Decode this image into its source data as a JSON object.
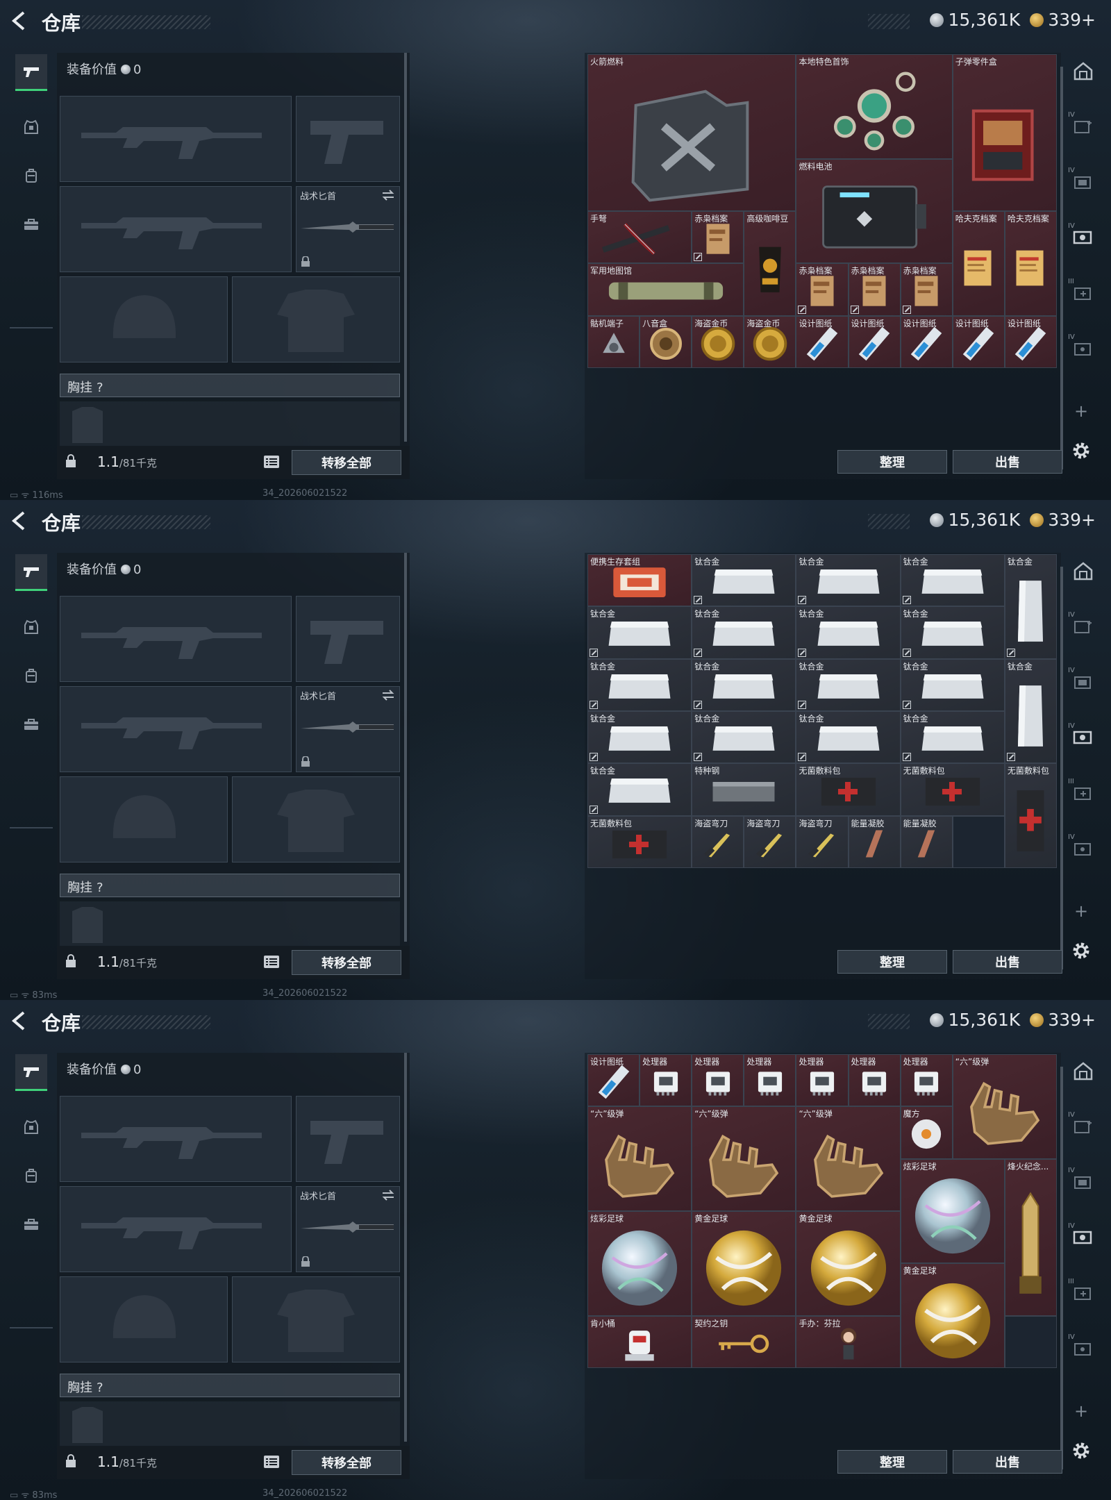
{
  "header": {
    "title": "仓库",
    "silver": "15,361K",
    "gold": "339+"
  },
  "equipment": {
    "value_label": "装备价值",
    "value": "0",
    "knife_label": "战术匕首",
    "chest_label": "胸挂",
    "chest_q": "?",
    "weight": "1.1",
    "weight_max": "/81千克",
    "transfer_label": "转移全部"
  },
  "stash_buttons": {
    "sort": "整理",
    "sell": "出售"
  },
  "build": "34_202606021522",
  "panels": [
    {
      "ping": "116ms",
      "items": [
        {
          "name": "火箭燃料",
          "c": 1,
          "r": 1,
          "cs": 4,
          "rs": 3,
          "t": "rare",
          "icon": "jerrycan"
        },
        {
          "name": "本地特色首饰",
          "c": 5,
          "r": 1,
          "cs": 3,
          "rs": 2,
          "t": "rare",
          "icon": "jewelry"
        },
        {
          "name": "子弹零件盒",
          "c": 8,
          "r": 1,
          "cs": 2,
          "rs": 3,
          "t": "rare",
          "icon": "box"
        },
        {
          "name": "燃料电池",
          "c": 5,
          "r": 3,
          "cs": 3,
          "rs": 2,
          "t": "rare",
          "icon": "battery"
        },
        {
          "name": "手弩",
          "c": 1,
          "r": 4,
          "cs": 2,
          "rs": 1,
          "t": "rare",
          "icon": "crossbow"
        },
        {
          "name": "赤枭档案",
          "c": 3,
          "r": 4,
          "cs": 1,
          "rs": 1,
          "t": "rare",
          "icon": "file",
          "tag": true
        },
        {
          "name": "高级咖啡豆",
          "c": 4,
          "r": 4,
          "cs": 1,
          "rs": 2,
          "t": "rare",
          "icon": "coffee"
        },
        {
          "name": "哈夫克档案",
          "c": 8,
          "r": 4,
          "cs": 1,
          "rs": 2,
          "t": "rare",
          "icon": "doc"
        },
        {
          "name": "哈夫克档案",
          "c": 9,
          "r": 4,
          "cs": 1,
          "rs": 2,
          "t": "rare",
          "icon": "doc"
        },
        {
          "name": "军用地图馆",
          "c": 1,
          "r": 5,
          "cs": 3,
          "rs": 1,
          "t": "rare",
          "icon": "tube"
        },
        {
          "name": "赤枭档案",
          "c": 5,
          "r": 5,
          "cs": 1,
          "rs": 1,
          "t": "rare",
          "icon": "file",
          "tag": true
        },
        {
          "name": "赤枭档案",
          "c": 6,
          "r": 5,
          "cs": 1,
          "rs": 1,
          "t": "rare",
          "icon": "file",
          "tag": true
        },
        {
          "name": "赤枭档案",
          "c": 7,
          "r": 5,
          "cs": 1,
          "rs": 1,
          "t": "rare",
          "icon": "file",
          "tag": true
        },
        {
          "name": "骷机端子",
          "c": 1,
          "r": 6,
          "cs": 1,
          "rs": 1,
          "t": "rare",
          "icon": "gear"
        },
        {
          "name": "八音盒",
          "c": 2,
          "r": 6,
          "cs": 1,
          "rs": 1,
          "t": "rare",
          "icon": "musicbox"
        },
        {
          "name": "海盗金币",
          "c": 3,
          "r": 6,
          "cs": 1,
          "rs": 1,
          "t": "rare",
          "icon": "coin"
        },
        {
          "name": "海盗金币",
          "c": 4,
          "r": 6,
          "cs": 1,
          "rs": 1,
          "t": "rare",
          "icon": "coin"
        },
        {
          "name": "设计图纸",
          "c": 5,
          "r": 6,
          "cs": 1,
          "rs": 1,
          "t": "rare",
          "icon": "blueprint"
        },
        {
          "name": "设计图纸",
          "c": 6,
          "r": 6,
          "cs": 1,
          "rs": 1,
          "t": "rare",
          "icon": "blueprint"
        },
        {
          "name": "设计图纸",
          "c": 7,
          "r": 6,
          "cs": 1,
          "rs": 1,
          "t": "rare",
          "icon": "blueprint"
        },
        {
          "name": "设计图纸",
          "c": 8,
          "r": 6,
          "cs": 1,
          "rs": 1,
          "t": "rare",
          "icon": "blueprint"
        },
        {
          "name": "设计图纸",
          "c": 9,
          "r": 6,
          "cs": 1,
          "rs": 1,
          "t": "rare",
          "icon": "blueprint"
        }
      ]
    },
    {
      "ping": "83ms",
      "items": [
        {
          "name": "便携生存套组",
          "c": 1,
          "r": 1,
          "cs": 2,
          "rs": 1,
          "t": "rare",
          "icon": "kit"
        },
        {
          "name": "钛合金",
          "c": 3,
          "r": 1,
          "cs": 2,
          "rs": 1,
          "t": "std",
          "icon": "plate",
          "tag": true
        },
        {
          "name": "钛合金",
          "c": 5,
          "r": 1,
          "cs": 2,
          "rs": 1,
          "t": "std",
          "icon": "plate",
          "tag": true
        },
        {
          "name": "钛合金",
          "c": 7,
          "r": 1,
          "cs": 2,
          "rs": 1,
          "t": "std",
          "icon": "plate",
          "tag": true
        },
        {
          "name": "钛合金",
          "c": 9,
          "r": 1,
          "cs": 1,
          "rs": 2,
          "t": "std",
          "icon": "plate-v",
          "tag": true
        },
        {
          "name": "钛合金",
          "c": 1,
          "r": 2,
          "cs": 2,
          "rs": 1,
          "t": "std",
          "icon": "plate",
          "tag": true
        },
        {
          "name": "钛合金",
          "c": 3,
          "r": 2,
          "cs": 2,
          "rs": 1,
          "t": "std",
          "icon": "plate",
          "tag": true
        },
        {
          "name": "钛合金",
          "c": 5,
          "r": 2,
          "cs": 2,
          "rs": 1,
          "t": "std",
          "icon": "plate",
          "tag": true
        },
        {
          "name": "钛合金",
          "c": 7,
          "r": 2,
          "cs": 2,
          "rs": 1,
          "t": "std",
          "icon": "plate",
          "tag": true
        },
        {
          "name": "钛合金",
          "c": 1,
          "r": 3,
          "cs": 2,
          "rs": 1,
          "t": "std",
          "icon": "plate",
          "tag": true
        },
        {
          "name": "钛合金",
          "c": 3,
          "r": 3,
          "cs": 2,
          "rs": 1,
          "t": "std",
          "icon": "plate",
          "tag": true
        },
        {
          "name": "钛合金",
          "c": 5,
          "r": 3,
          "cs": 2,
          "rs": 1,
          "t": "std",
          "icon": "plate",
          "tag": true
        },
        {
          "name": "钛合金",
          "c": 7,
          "r": 3,
          "cs": 2,
          "rs": 1,
          "t": "std",
          "icon": "plate",
          "tag": true
        },
        {
          "name": "钛合金",
          "c": 9,
          "r": 3,
          "cs": 1,
          "rs": 2,
          "t": "std",
          "icon": "plate-v",
          "tag": true
        },
        {
          "name": "钛合金",
          "c": 1,
          "r": 4,
          "cs": 2,
          "rs": 1,
          "t": "std",
          "icon": "plate",
          "tag": true
        },
        {
          "name": "钛合金",
          "c": 3,
          "r": 4,
          "cs": 2,
          "rs": 1,
          "t": "std",
          "icon": "plate",
          "tag": true
        },
        {
          "name": "钛合金",
          "c": 5,
          "r": 4,
          "cs": 2,
          "rs": 1,
          "t": "std",
          "icon": "plate",
          "tag": true
        },
        {
          "name": "钛合金",
          "c": 7,
          "r": 4,
          "cs": 2,
          "rs": 1,
          "t": "std",
          "icon": "plate",
          "tag": true
        },
        {
          "name": "钛合金",
          "c": 1,
          "r": 5,
          "cs": 2,
          "rs": 1,
          "t": "std",
          "icon": "plate",
          "tag": true
        },
        {
          "name": "特种钢",
          "c": 3,
          "r": 5,
          "cs": 2,
          "rs": 1,
          "t": "std",
          "icon": "steel"
        },
        {
          "name": "无菌敷料包",
          "c": 5,
          "r": 5,
          "cs": 2,
          "rs": 1,
          "t": "std",
          "icon": "medpack"
        },
        {
          "name": "无菌敷料包",
          "c": 7,
          "r": 5,
          "cs": 2,
          "rs": 1,
          "t": "std",
          "icon": "medpack"
        },
        {
          "name": "无菌敷料包",
          "c": 9,
          "r": 5,
          "cs": 1,
          "rs": 2,
          "t": "std",
          "icon": "medpack-v"
        },
        {
          "name": "无菌敷料包",
          "c": 1,
          "r": 6,
          "cs": 2,
          "rs": 1,
          "t": "std",
          "icon": "medpack"
        },
        {
          "name": "海盗弯刀",
          "c": 3,
          "r": 6,
          "cs": 1,
          "rs": 1,
          "t": "std",
          "icon": "dagger"
        },
        {
          "name": "海盗弯刀",
          "c": 4,
          "r": 6,
          "cs": 1,
          "rs": 1,
          "t": "std",
          "icon": "dagger"
        },
        {
          "name": "海盗弯刀",
          "c": 5,
          "r": 6,
          "cs": 1,
          "rs": 1,
          "t": "std",
          "icon": "dagger"
        },
        {
          "name": "能量凝胶",
          "c": 6,
          "r": 6,
          "cs": 1,
          "rs": 1,
          "t": "std",
          "icon": "gel"
        },
        {
          "name": "能量凝胶",
          "c": 7,
          "r": 6,
          "cs": 1,
          "rs": 1,
          "t": "std",
          "icon": "gel"
        },
        {
          "name": "",
          "c": 8,
          "r": 6,
          "cs": 1,
          "rs": 1,
          "t": "empty",
          "icon": ""
        }
      ]
    },
    {
      "ping": "83ms",
      "items": [
        {
          "name": "设计图纸",
          "c": 1,
          "r": 1,
          "cs": 1,
          "rs": 1,
          "t": "rare",
          "icon": "blueprint"
        },
        {
          "name": "处理器",
          "c": 2,
          "r": 1,
          "cs": 1,
          "rs": 1,
          "t": "rare",
          "icon": "chip"
        },
        {
          "name": "处理器",
          "c": 3,
          "r": 1,
          "cs": 1,
          "rs": 1,
          "t": "rare",
          "icon": "chip"
        },
        {
          "name": "处理器",
          "c": 4,
          "r": 1,
          "cs": 1,
          "rs": 1,
          "t": "rare",
          "icon": "chip"
        },
        {
          "name": "处理器",
          "c": 5,
          "r": 1,
          "cs": 1,
          "rs": 1,
          "t": "rare",
          "icon": "chip"
        },
        {
          "name": "处理器",
          "c": 6,
          "r": 1,
          "cs": 1,
          "rs": 1,
          "t": "rare",
          "icon": "chip"
        },
        {
          "name": "处理器",
          "c": 7,
          "r": 1,
          "cs": 1,
          "rs": 1,
          "t": "rare",
          "icon": "chip"
        },
        {
          "name": "“六”级弹",
          "c": 8,
          "r": 1,
          "cs": 2,
          "rs": 2,
          "t": "rare",
          "icon": "hand"
        },
        {
          "name": "“六”级弹",
          "c": 1,
          "r": 2,
          "cs": 2,
          "rs": 2,
          "t": "rare",
          "icon": "hand"
        },
        {
          "name": "“六”级弹",
          "c": 3,
          "r": 2,
          "cs": 2,
          "rs": 2,
          "t": "rare",
          "icon": "hand"
        },
        {
          "name": "“六”级弹",
          "c": 5,
          "r": 2,
          "cs": 2,
          "rs": 2,
          "t": "rare",
          "icon": "hand"
        },
        {
          "name": "魔方",
          "c": 7,
          "r": 2,
          "cs": 1,
          "rs": 1,
          "t": "rare",
          "icon": "cube"
        },
        {
          "name": "炫彩足球",
          "c": 7,
          "r": 3,
          "cs": 2,
          "rs": 2,
          "t": "rare",
          "icon": "ball-silver"
        },
        {
          "name": "烽火纪念...",
          "c": 9,
          "r": 3,
          "cs": 1,
          "rs": 3,
          "t": "rare",
          "icon": "trophy"
        },
        {
          "name": "炫彩足球",
          "c": 1,
          "r": 4,
          "cs": 2,
          "rs": 2,
          "t": "rare",
          "icon": "ball-silver"
        },
        {
          "name": "黄金足球",
          "c": 3,
          "r": 4,
          "cs": 2,
          "rs": 2,
          "t": "rare",
          "icon": "ball-gold"
        },
        {
          "name": "黄金足球",
          "c": 5,
          "r": 4,
          "cs": 2,
          "rs": 2,
          "t": "rare",
          "icon": "ball-gold"
        },
        {
          "name": "黄金足球",
          "c": 7,
          "r": 5,
          "cs": 2,
          "rs": 2,
          "t": "rare",
          "icon": "ball-gold"
        },
        {
          "name": "肯小桶",
          "c": 1,
          "r": 6,
          "cs": 2,
          "rs": 1,
          "t": "rare",
          "icon": "robot"
        },
        {
          "name": "契约之钥",
          "c": 3,
          "r": 6,
          "cs": 2,
          "rs": 1,
          "t": "rare",
          "icon": "key"
        },
        {
          "name": "手办：芬拉",
          "c": 5,
          "r": 6,
          "cs": 2,
          "rs": 1,
          "t": "rare",
          "icon": "figure"
        },
        {
          "name": "",
          "c": 9,
          "r": 6,
          "cs": 1,
          "rs": 1,
          "t": "empty",
          "icon": ""
        }
      ]
    }
  ]
}
